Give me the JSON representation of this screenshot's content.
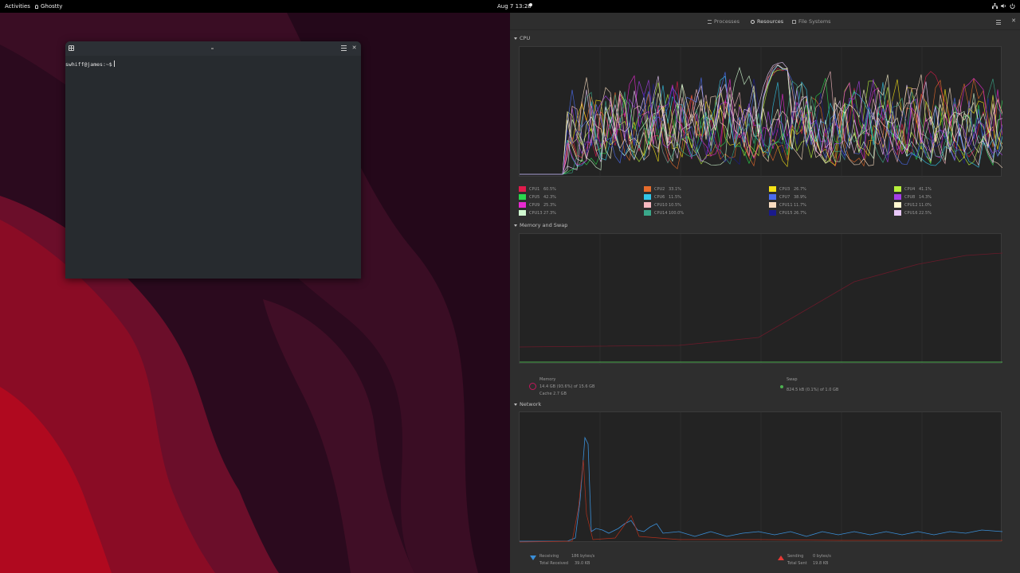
{
  "topbar": {
    "activities": "Activities",
    "app_name": "Ghostty",
    "clock": "Aug 7  13:28",
    "status_icons": [
      "network-icon",
      "volume-icon",
      "power-icon"
    ]
  },
  "terminal": {
    "prompt": "swhiff@james:~$"
  },
  "monitor": {
    "tabs": [
      {
        "label": "Processes",
        "active": false
      },
      {
        "label": "Resources",
        "active": true
      },
      {
        "label": "File Systems",
        "active": false
      }
    ],
    "cpu": {
      "title": "CPU",
      "items": [
        {
          "name": "CPU1",
          "value": "60.5%",
          "color": "#e01b4c"
        },
        {
          "name": "CPU2",
          "value": "33.1%",
          "color": "#e66c2c"
        },
        {
          "name": "CPU3",
          "value": "26.7%",
          "color": "#f5e216"
        },
        {
          "name": "CPU4",
          "value": "41.1%",
          "color": "#b7f03c"
        },
        {
          "name": "CPU5",
          "value": "42.3%",
          "color": "#2ad84e"
        },
        {
          "name": "CPU6",
          "value": "11.5%",
          "color": "#33c6e8"
        },
        {
          "name": "CPU7",
          "value": "38.9%",
          "color": "#4a6cf0"
        },
        {
          "name": "CPU8",
          "value": "14.3%",
          "color": "#a43ee8"
        },
        {
          "name": "CPU9",
          "value": "25.3%",
          "color": "#e82ad0"
        },
        {
          "name": "CPU10",
          "value": "10.5%",
          "color": "#f5b8c0"
        },
        {
          "name": "CPU11",
          "value": "11.7%",
          "color": "#f8dcc0"
        },
        {
          "name": "CPU12",
          "value": "11.0%",
          "color": "#fff8d0"
        },
        {
          "name": "CPU13",
          "value": "27.3%",
          "color": "#d0f8d0"
        },
        {
          "name": "CPU14",
          "value": "100.0%",
          "color": "#3aa88a"
        },
        {
          "name": "CPU15",
          "value": "26.7%",
          "color": "#1a1a8c"
        },
        {
          "name": "CPU16",
          "value": "22.5%",
          "color": "#e8c8f8"
        }
      ]
    },
    "memory": {
      "title": "Memory and Swap",
      "memory_label": "Memory",
      "memory_value": "14.4 GB (93.6%) of 15.6 GB",
      "cache_value": "Cache 2.7 GB",
      "swap_label": "Swap",
      "swap_value": "824.5 kB (0.1%) of 1.0 GB"
    },
    "network": {
      "title": "Network",
      "receiving_label": "Receiving",
      "receiving_value": "186 bytes/s",
      "total_received_label": "Total Received",
      "total_received_value": "39.0 KB",
      "sending_label": "Sending",
      "sending_value": "0 bytes/s",
      "total_sent_label": "Total Sent",
      "total_sent_value": "19.8 KB"
    }
  }
}
